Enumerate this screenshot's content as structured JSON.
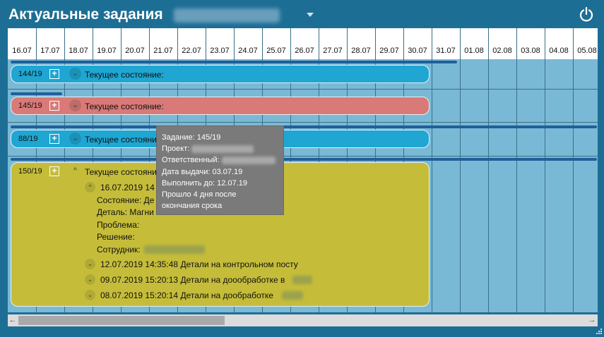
{
  "header": {
    "title": "Актуальные задания"
  },
  "dates": [
    "16.07",
    "17.07",
    "18.07",
    "19.07",
    "20.07",
    "21.07",
    "22.07",
    "23.07",
    "24.07",
    "25.07",
    "26.07",
    "27.07",
    "28.07",
    "29.07",
    "30.07",
    "31.07",
    "01.08",
    "02.08",
    "03.08",
    "04.08",
    "05.08"
  ],
  "tasks": [
    {
      "id": "144/19",
      "plus": "+",
      "toggle": "⌄",
      "state_label": "Текущее состояние:",
      "color": "#1fa6d2"
    },
    {
      "id": "145/19",
      "plus": "+",
      "toggle": "⌄",
      "state_label": "Текущее состояние:",
      "color": "#d97a78"
    },
    {
      "id": "88/19",
      "plus": "+",
      "toggle": "⌄",
      "state_label": "Текущее состояние:",
      "color": "#1fa6d2"
    },
    {
      "id": "150/19",
      "plus": "+",
      "toggle": "^",
      "state_label": "Текущее состояние:",
      "color": "#c5bd3a",
      "entries": [
        {
          "toggle": "^",
          "datetime": "16.07.2019 14",
          "details": {
            "state": "Состояние: Де",
            "part": "Деталь: Магни",
            "problem": "Проблема:",
            "solution": "Решение:",
            "employee": "Сотрудник:"
          }
        },
        {
          "toggle": "⌄",
          "text": "12.07.2019 14:35:48 Детали на контрольном посту"
        },
        {
          "toggle": "⌄",
          "text": "09.07.2019 15:20:13 Детали на доообработке в"
        },
        {
          "toggle": "⌄",
          "text": "08.07.2019 15:20:14 Детали на дообработке"
        }
      ]
    }
  ],
  "tooltip": {
    "task": "Задание: 145/19",
    "project": "Проект:",
    "responsible": "Ответственный:",
    "issue_date": "Дата выдачи: 03.07.19",
    "due_date": "Выполнить до: 12.07.19",
    "overdue_line1": "Прошло 4 дня после",
    "overdue_line2": "окончания срока"
  },
  "scrollbar": {
    "left_arrow": "←",
    "right_arrow": "→"
  },
  "colors": {
    "accent": "#1d6e95",
    "board": "#7ab9d6",
    "task_blue": "#1fa6d2",
    "task_red": "#d97a78",
    "task_yellow": "#c5bd3a",
    "tooltip": "#7a7a7a"
  }
}
